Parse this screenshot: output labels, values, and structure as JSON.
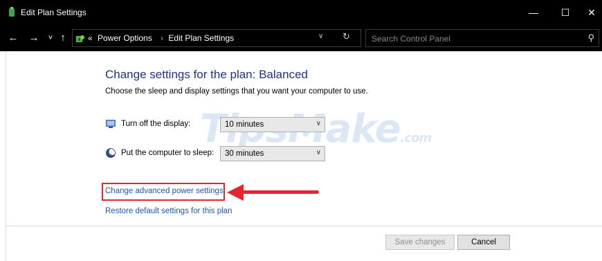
{
  "window": {
    "title": "Edit Plan Settings",
    "minimize": "—",
    "maximize": "☐",
    "close": "✕"
  },
  "nav": {
    "back": "←",
    "forward": "→",
    "recent": "˅",
    "up": "↑"
  },
  "address": {
    "overflow": "«",
    "crumbs": [
      "Power Options",
      "Edit Plan Settings"
    ],
    "separator": "›",
    "dropdown": "∨",
    "refresh": "↻"
  },
  "search": {
    "placeholder": "Search Control Panel",
    "icon": "⚲"
  },
  "main": {
    "heading": "Change settings for the plan: Balanced",
    "subtext": "Choose the sleep and display settings that you want your computer to use.",
    "display": {
      "label": "Turn off the display:",
      "value": "10 minutes"
    },
    "sleep": {
      "label": "Put the computer to sleep:",
      "value": "30 minutes"
    },
    "advanced_link": "Change advanced power settings",
    "restore_link": "Restore default settings for this plan",
    "watermark": "TipsMake",
    "watermark_suffix": ".com"
  },
  "buttons": {
    "save": "Save changes",
    "cancel": "Cancel"
  },
  "colors": {
    "heading": "#1e3287",
    "link": "#1a57b5",
    "annotation": "#e6262c",
    "titlebar": "#000000"
  }
}
